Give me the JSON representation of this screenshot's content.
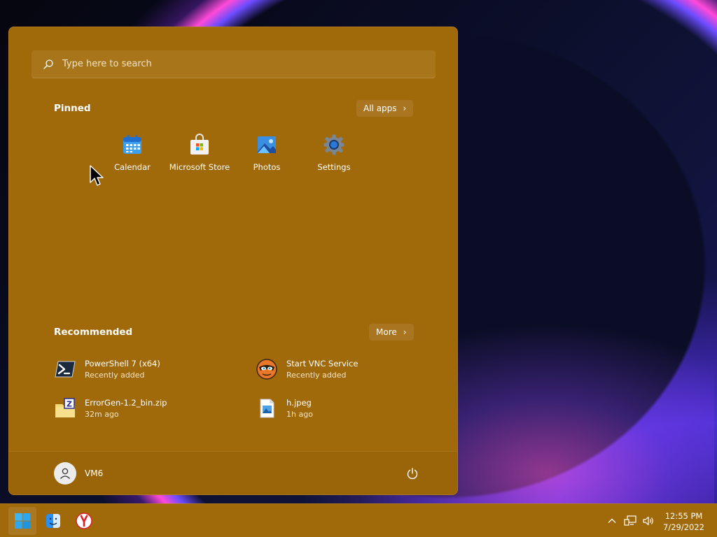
{
  "search": {
    "placeholder": "Type here to search"
  },
  "pinned": {
    "title": "Pinned",
    "all_apps_label": "All apps",
    "apps": [
      {
        "label": "Calendar",
        "icon": "calendar-icon"
      },
      {
        "label": "Microsoft Store",
        "icon": "store-icon"
      },
      {
        "label": "Photos",
        "icon": "photos-icon"
      },
      {
        "label": "Settings",
        "icon": "gear-icon"
      }
    ]
  },
  "recommended": {
    "title": "Recommended",
    "more_label": "More",
    "items": [
      {
        "name": "PowerShell 7 (x64)",
        "sub": "Recently added",
        "icon": "powershell-icon"
      },
      {
        "name": "Start VNC Service",
        "sub": "Recently added",
        "icon": "vnc-icon"
      },
      {
        "name": "ErrorGen-1.2_bin.zip",
        "sub": "32m ago",
        "icon": "zip-file-icon"
      },
      {
        "name": "h.jpeg",
        "sub": "1h ago",
        "icon": "image-file-icon"
      }
    ]
  },
  "user": {
    "name": "VM6"
  },
  "taskbar": {
    "apps": [
      "windows-start-icon",
      "finder-icon",
      "yandex-browser-icon"
    ],
    "clock": {
      "time": "12:55 PM",
      "date": "7/29/2022"
    }
  },
  "colors": {
    "accent": "#a06a0a",
    "taskbar": "#a06a0a"
  }
}
